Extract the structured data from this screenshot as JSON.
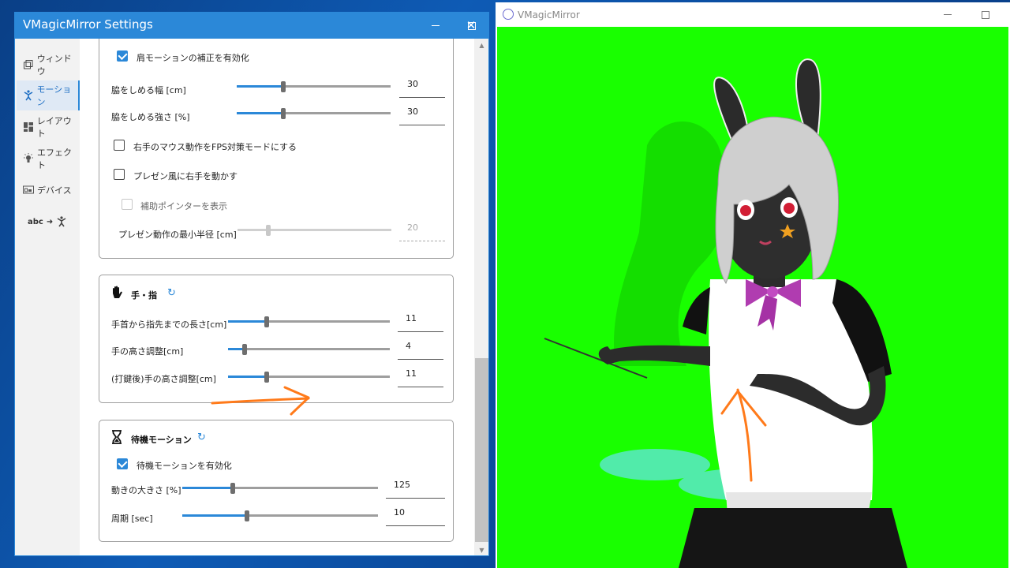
{
  "settings_window": {
    "title": "VMagicMirror Settings"
  },
  "nav": {
    "items": [
      {
        "label": "ウィンドウ",
        "icon": "window-icon"
      },
      {
        "label": "モーション",
        "icon": "motion-figure-icon"
      },
      {
        "label": "レイアウト",
        "icon": "layout-grid-icon"
      },
      {
        "label": "エフェクト",
        "icon": "lightbulb-icon"
      },
      {
        "label": "デバイス",
        "icon": "device-icon"
      },
      {
        "label": "abc",
        "icon": "word-to-motion-icon"
      }
    ],
    "active_index": 1
  },
  "arm_section": {
    "shoulder_correction": {
      "label": "肩モーションの補正を有効化",
      "checked": true
    },
    "waist_width": {
      "label": "脇をしめる幅 [cm]",
      "value": "30",
      "fraction": 0.3
    },
    "waist_strength": {
      "label": "脇をしめる強さ [%]",
      "value": "30",
      "fraction": 0.3
    },
    "fps_mode": {
      "label": "右手のマウス動作をFPS対策モードにする",
      "checked": false
    },
    "presentation_mode": {
      "label": "プレゼン風に右手を動かす",
      "checked": false
    },
    "show_pointer": {
      "label": "補助ポインターを表示",
      "checked": false
    },
    "presentation_radius": {
      "label": "プレゼン動作の最小半径 [cm]",
      "value": "20",
      "fraction": 0.2
    }
  },
  "hand_section": {
    "title": "手・指",
    "hand_icon": "hand-icon",
    "reset_icon": "refresh-icon",
    "wrist_to_tip": {
      "label": "手首から指先までの長さ[cm]",
      "value": "11",
      "fraction": 0.24
    },
    "hand_height": {
      "label": "手の高さ調整[cm]",
      "value": "4",
      "fraction": 0.1
    },
    "hand_height_after_typing": {
      "label": "(打鍵後)手の高さ調整[cm]",
      "value": "11",
      "fraction": 0.24
    }
  },
  "wait_section": {
    "title": "待機モーション",
    "hourglass_icon": "hourglass-icon",
    "reset_icon": "refresh-icon",
    "enable_wait_motion": {
      "label": "待機モーションを有効化",
      "checked": true
    },
    "motion_scale": {
      "label": "動きの大きさ [%]",
      "value": "125",
      "fraction": 0.26
    },
    "period": {
      "label": "周期 [sec]",
      "value": "10",
      "fraction": 0.33
    }
  },
  "vmm_window": {
    "title": "VMagicMirror",
    "background": "#19ff00"
  },
  "colors": {
    "accent": "#2b88d8",
    "annotation": "#ff7a1a"
  }
}
